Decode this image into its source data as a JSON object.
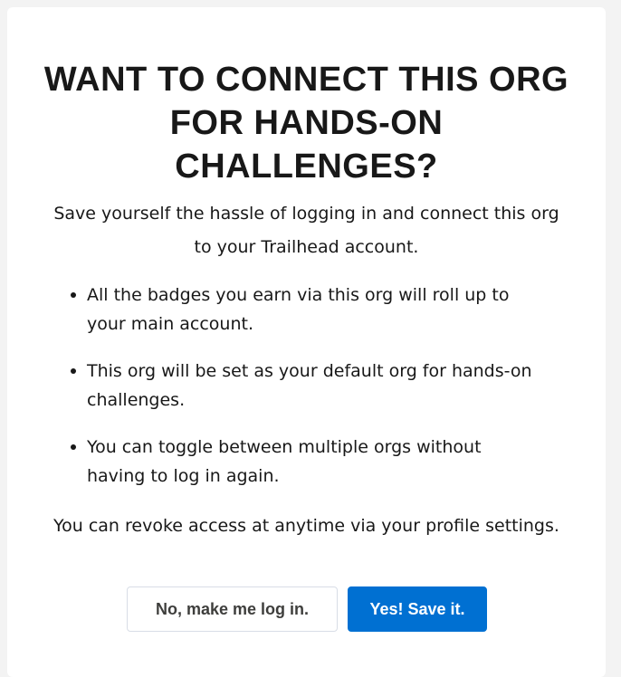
{
  "modal": {
    "title": "WANT TO CONNECT THIS ORG FOR HANDS-ON CHALLENGES?",
    "intro": "Save yourself the hassle of logging in and connect this org to your Trailhead account.",
    "bullets": [
      "All the badges you earn via this org will roll up to your main account.",
      "This org will be set as your default org for hands-on challenges.",
      "You can toggle between multiple orgs without having to log in again."
    ],
    "footer_note": "You can revoke access at anytime via your profile settings.",
    "secondary_button": "No, make me log in.",
    "primary_button": "Yes! Save it."
  },
  "colors": {
    "primary": "#0070d2",
    "text": "#181818",
    "background": "#ffffff"
  }
}
